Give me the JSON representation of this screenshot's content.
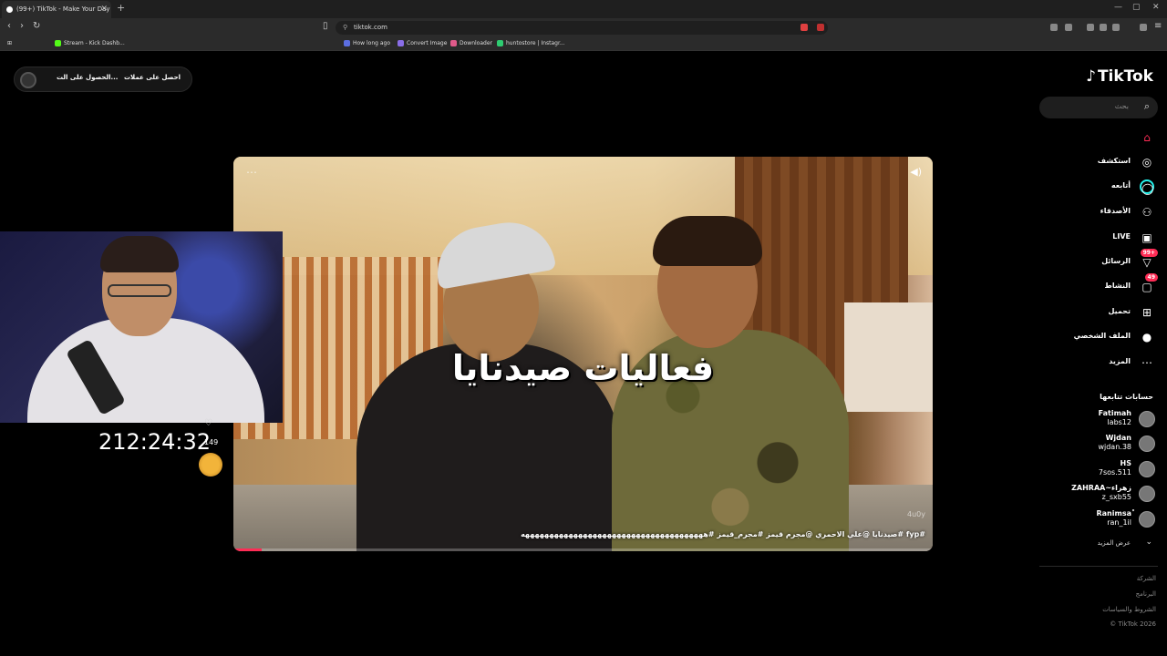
{
  "browser": {
    "tab_title": "(99+) TikTok - Make Your Day",
    "url": "tiktok.com",
    "bookmarks": [
      {
        "label": "Stream - Kick Dashb...",
        "color": "#53fc18"
      },
      {
        "label": "How long ago",
        "color": "#5b6ee1"
      },
      {
        "label": "Convert Image",
        "color": "#8a6ee8"
      },
      {
        "label": "Downloader",
        "color": "#e05a8a"
      },
      {
        "label": "huntostore | Instagr...",
        "color": "#2ecc71"
      }
    ]
  },
  "top_pill": {
    "get_app": "احصل على عملات",
    "get_coins": "الحصول على الت..."
  },
  "video": {
    "caption": "فعاليات صيدنايا",
    "description": "#fyp #صيدنايا @علي الاحمري @مجرم قيمز #مجرم_قيمز #ههههههههههههههههههههههههههههههههههههههه",
    "progress": 0.04,
    "watermark": "4u0y"
  },
  "stream_overlay": {
    "timer": "212:24:32",
    "gift_count": "149"
  },
  "sidebar": {
    "logo": "TikTok",
    "search_placeholder": "بحث",
    "nav": [
      {
        "label": "",
        "icon": "home-icon"
      },
      {
        "label": "استكشف",
        "icon": "compass-icon"
      },
      {
        "label": "أتابعه",
        "icon": "following-icon"
      },
      {
        "label": "الأصدقاء",
        "icon": "friends-icon"
      },
      {
        "label": "LIVE",
        "icon": "live-icon"
      },
      {
        "label": "الرسائل",
        "icon": "messages-icon",
        "badge": "99+"
      },
      {
        "label": "النشاط",
        "icon": "activity-icon",
        "badge": "49"
      },
      {
        "label": "تحميل",
        "icon": "upload-icon"
      },
      {
        "label": "الملف الشخصي",
        "icon": "profile-icon"
      },
      {
        "label": "المزيد",
        "icon": "more-icon"
      }
    ],
    "following_title": "حسابات تتابعها",
    "following": [
      {
        "name": "Fatimah",
        "handle": "labs12"
      },
      {
        "name": "Wjdan",
        "handle": "wjdan.38"
      },
      {
        "name": "HS",
        "handle": "7sos.511"
      },
      {
        "name": "ZAHRAA~زهراء",
        "handle": "z_sxb55"
      },
      {
        "name": "Ranimsaْ",
        "handle": "ran_1il"
      }
    ],
    "show_more": "عرض المزيد",
    "footer": [
      "الشركة",
      "البرنامج",
      "الشروط والسياسات",
      "© TikTok 2026"
    ]
  }
}
